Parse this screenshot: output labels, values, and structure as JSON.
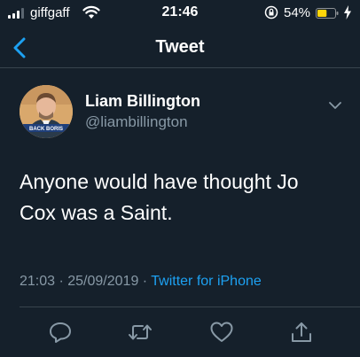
{
  "status_bar": {
    "carrier": "giffgaff",
    "time": "21:46",
    "battery_percent": "54%",
    "battery_level": 0.54,
    "colors": {
      "battery_fill": "#ffd60a"
    }
  },
  "nav": {
    "title": "Tweet",
    "back_icon": "chevron-left-icon"
  },
  "tweet": {
    "author_name": "Liam Billington",
    "author_handle": "@liambillington",
    "avatar_badge": "BACK BORIS",
    "text": "Anyone would have thought Jo Cox was a Saint.",
    "timestamp": "21:03 · 25/09/2019 · ",
    "source": "Twitter for iPhone"
  },
  "actions": [
    {
      "icon": "reply-icon"
    },
    {
      "icon": "retweet-icon"
    },
    {
      "icon": "like-icon"
    },
    {
      "icon": "share-icon"
    }
  ],
  "colors": {
    "background": "#15202b",
    "text_secondary": "#8899a6",
    "accent": "#1da1f2",
    "divider": "#38444d"
  }
}
